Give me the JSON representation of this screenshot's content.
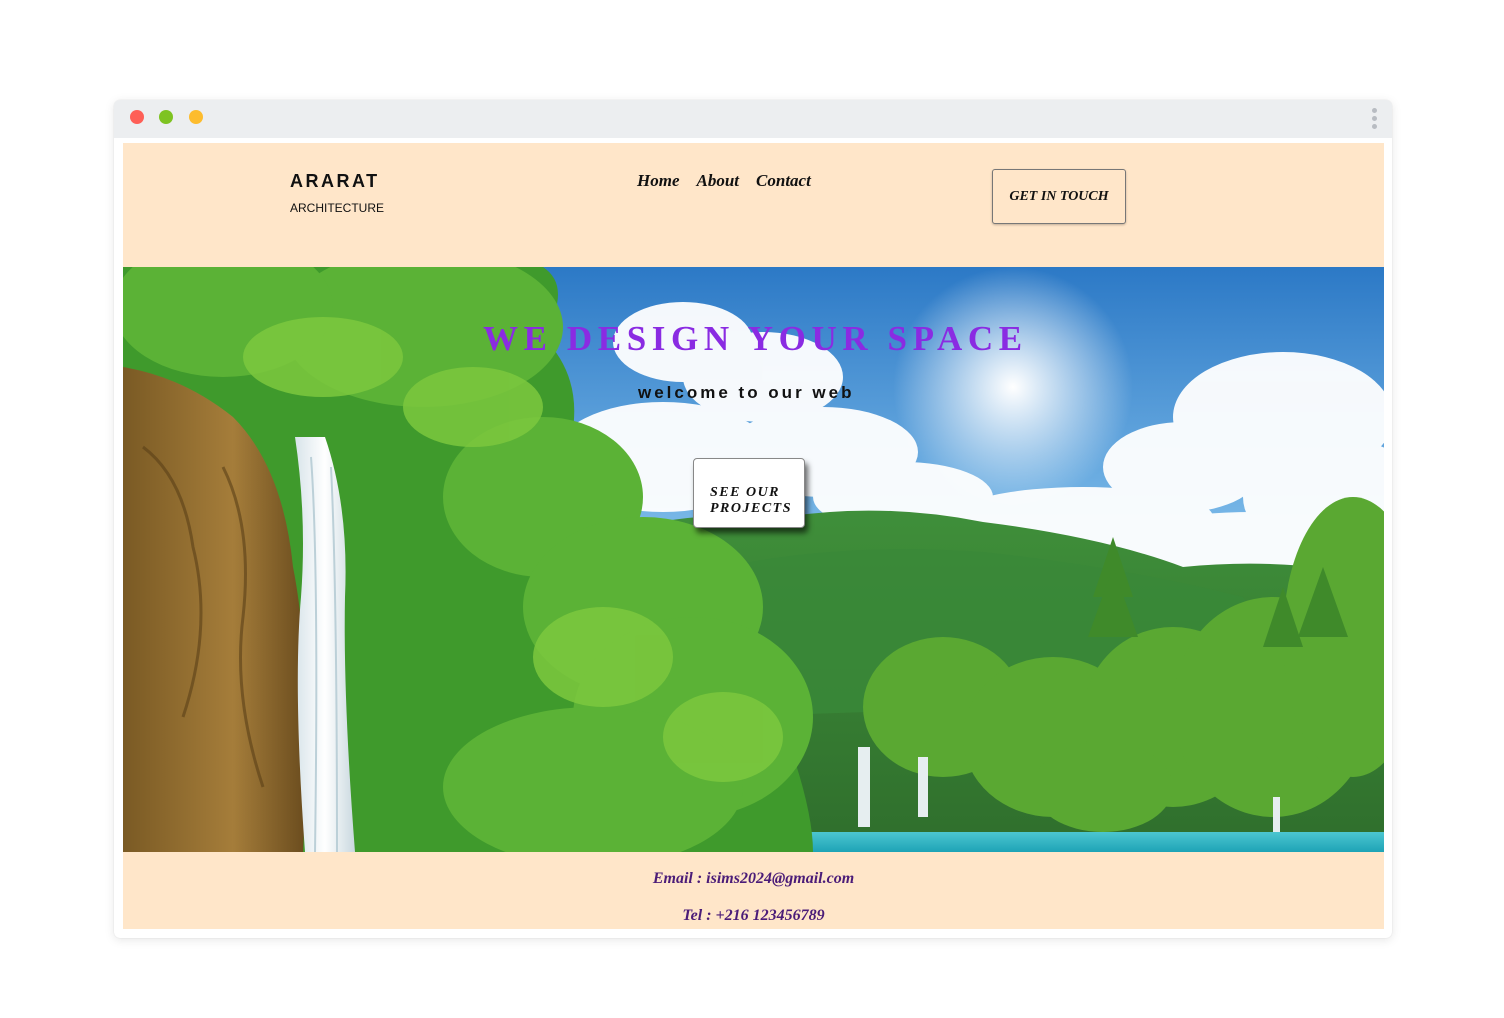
{
  "brand": {
    "name": "ARARAT",
    "subtitle": "ARCHITECTURE"
  },
  "nav": {
    "items": [
      {
        "label": "Home"
      },
      {
        "label": "About"
      },
      {
        "label": "Contact"
      }
    ]
  },
  "header": {
    "cta_label": "GET IN TOUCH"
  },
  "hero": {
    "title": "WE DESIGN YOUR SPACE",
    "subtitle": "welcome to our web",
    "button_line1": "SEE OUR",
    "button_line2": "PROJECTS",
    "background": "landscape-waterfall-image"
  },
  "footer": {
    "email": "Email : isims2024@gmail.com",
    "tel": "Tel : +216 123456789"
  },
  "colors": {
    "page_background": "#ffe6c9",
    "hero_title": "#8a2be2",
    "footer_text": "#4b1c78",
    "window_dot_red": "#fe5f57",
    "window_dot_green": "#7ec321",
    "window_dot_yellow": "#fdbc2e"
  }
}
